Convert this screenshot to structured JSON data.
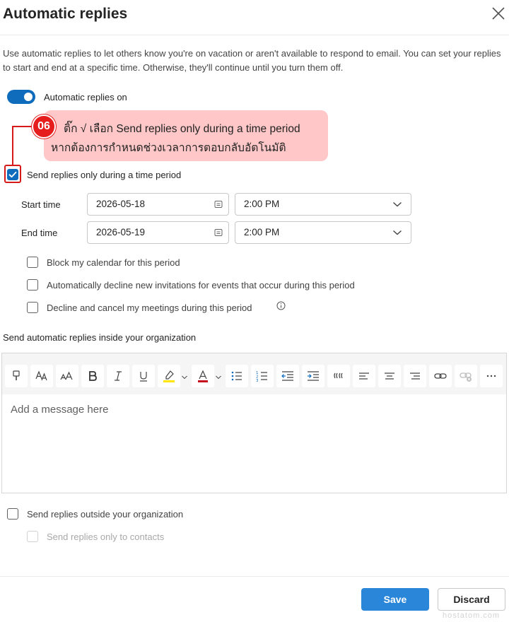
{
  "dialog": {
    "title": "Automatic replies",
    "description": "Use automatic replies to let others know you're on vacation or aren't available to respond to email. You can set your replies to start and end at a specific time. Otherwise, they'll continue until you turn them off."
  },
  "toggle": {
    "label": "Automatic replies on",
    "on": true
  },
  "annotation": {
    "badge": "06",
    "line1": "ติ๊ก √ เลือก Send replies only during a time period",
    "line2": "หากต้องการกำหนดช่วงเวลาการตอบกลับอัตโนมัติ"
  },
  "time_period": {
    "label": "Send replies only during a time period",
    "checked": true,
    "start_label": "Start time",
    "start_date": "2026-05-18",
    "start_time": "2:00 PM",
    "end_label": "End time",
    "end_date": "2026-05-19",
    "end_time": "2:00 PM"
  },
  "options": [
    {
      "label": "Block my calendar for this period"
    },
    {
      "label": "Automatically decline new invitations for events that occur during this period"
    },
    {
      "label": "Decline and cancel my meetings during this period"
    }
  ],
  "inside": {
    "label": "Send automatic replies inside your organization",
    "placeholder": "Add a message here"
  },
  "outside": {
    "label": "Send replies outside your organization",
    "contacts_label": "Send replies only to contacts"
  },
  "buttons": {
    "save": "Save",
    "discard": "Discard"
  },
  "watermark": "hostatom.com",
  "colors": {
    "accent": "#0f6cbd",
    "save": "#2a86d8",
    "annotation": "#e51d1d",
    "annotation_bg": "#ffc7c7"
  }
}
